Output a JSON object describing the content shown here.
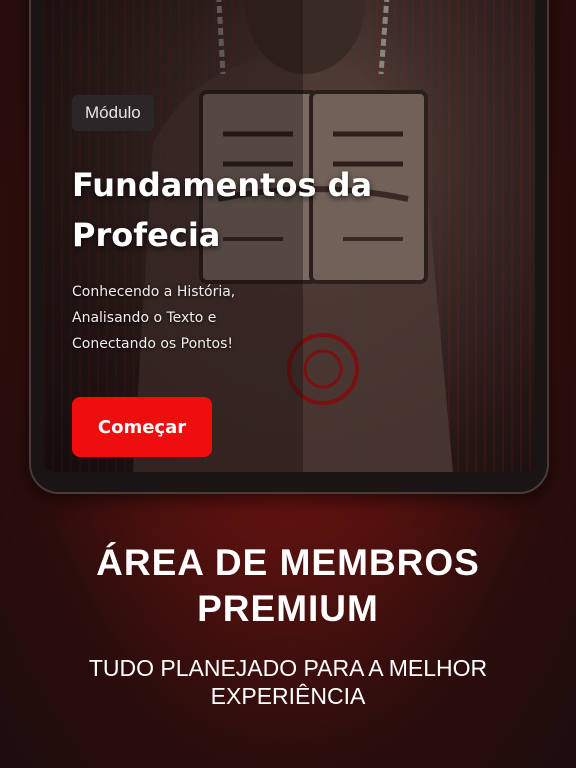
{
  "module_card": {
    "badge": "Módulo",
    "title": "Fundamentos da Profecia",
    "subtitle": "Conhecendo a História, Analisando o Texto e Conectando os Pontos!",
    "start_button": "Começar"
  },
  "promo": {
    "headline": "ÁREA DE MEMBROS PREMIUM",
    "tagline": "TUDO PLANEJADO PARA A MELHOR EXPERIÊNCIA"
  },
  "colors": {
    "accent": "#ef0d0d",
    "background_top": "#8a1a16",
    "background_bottom": "#1d0d0d"
  }
}
